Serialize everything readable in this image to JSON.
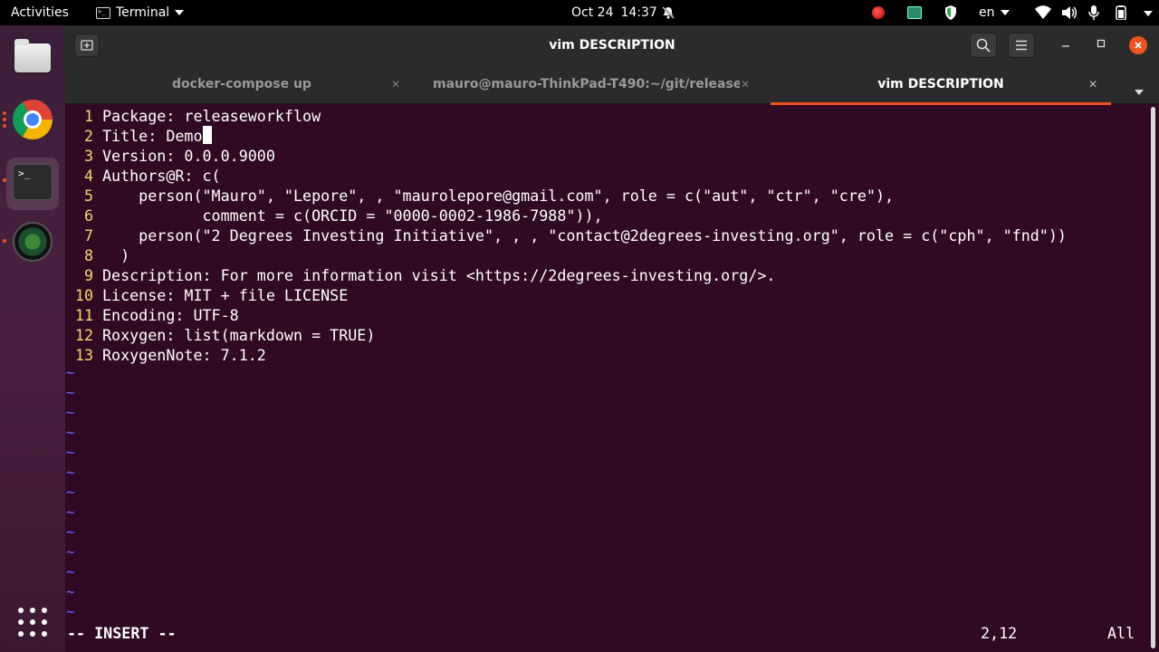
{
  "topbar": {
    "activities": "Activities",
    "app_name": "Terminal",
    "date": "Oct 24",
    "time": "14:37",
    "language": "en"
  },
  "window": {
    "title": "vim DESCRIPTION",
    "tabs": [
      {
        "label": "docker-compose up",
        "active": false
      },
      {
        "label": "mauro@mauro-ThinkPad-T490:~/git/release...",
        "active": false
      },
      {
        "label": "vim DESCRIPTION",
        "active": true
      }
    ]
  },
  "vim": {
    "lines": [
      {
        "num": "1",
        "text": "Package: releaseworkflow"
      },
      {
        "num": "2",
        "text": "Title: Demo"
      },
      {
        "num": "3",
        "text": "Version: 0.0.0.9000"
      },
      {
        "num": "4",
        "text": "Authors@R: c("
      },
      {
        "num": "5",
        "text": "    person(\"Mauro\", \"Lepore\", , \"maurolepore@gmail.com\", role = c(\"aut\", \"ctr\", \"cre\"),"
      },
      {
        "num": "6",
        "text": "           comment = c(ORCID = \"0000-0002-1986-7988\")),"
      },
      {
        "num": "7",
        "text": "    person(\"2 Degrees Investing Initiative\", , , \"contact@2degrees-investing.org\", role = c(\"cph\", \"fnd\"))"
      },
      {
        "num": "8",
        "text": "  )"
      },
      {
        "num": "9",
        "text": "Description: For more information visit <https://2degrees-investing.org/>."
      },
      {
        "num": "10",
        "text": "License: MIT + file LICENSE"
      },
      {
        "num": "11",
        "text": "Encoding: UTF-8"
      },
      {
        "num": "12",
        "text": "Roxygen: list(markdown = TRUE)"
      },
      {
        "num": "13",
        "text": "RoxygenNote: 7.1.2"
      }
    ],
    "tilde": "~",
    "empty_line_count": 13,
    "mode": "-- INSERT --",
    "cursor_position": "2,12",
    "scroll": "All"
  },
  "colors": {
    "terminal_bg": "#300a24",
    "line_number": "#f5d76e",
    "tilde": "#6a6aff",
    "accent": "#e95420"
  }
}
